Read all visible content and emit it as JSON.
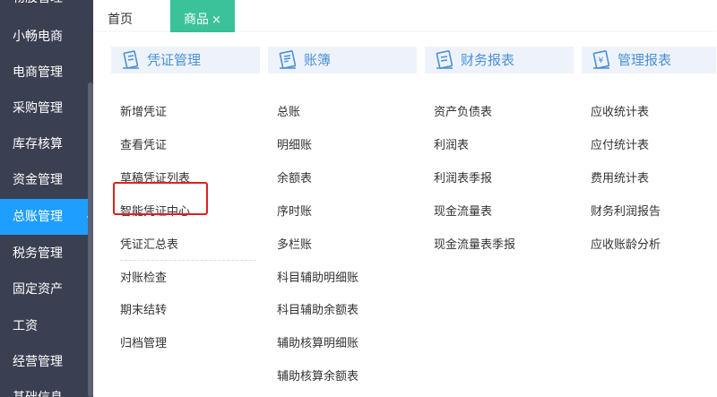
{
  "sidebar": {
    "items": [
      {
        "label": "物股管理",
        "active": false
      },
      {
        "label": "小畅电商",
        "active": false
      },
      {
        "label": "电商管理",
        "active": false
      },
      {
        "label": "采购管理",
        "active": false
      },
      {
        "label": "库存核算",
        "active": false
      },
      {
        "label": "资金管理",
        "active": false
      },
      {
        "label": "总账管理",
        "active": true
      },
      {
        "label": "税务管理",
        "active": false
      },
      {
        "label": "固定资产",
        "active": false
      },
      {
        "label": "工资",
        "active": false
      },
      {
        "label": "经营管理",
        "active": false
      },
      {
        "label": "基础信息",
        "active": false
      }
    ]
  },
  "tabs": {
    "home": "首页",
    "goods": "商品",
    "close": "×"
  },
  "columns": [
    {
      "title": "凭证管理",
      "icon": "voucher-icon",
      "items": [
        "新增凭证",
        "查看凭证",
        "草稿凭证列表",
        "智能凭证中心",
        "凭证汇总表",
        "对账检查",
        "期末结转",
        "归档管理"
      ]
    },
    {
      "title": "账簿",
      "icon": "ledger-icon",
      "items": [
        "总账",
        "明细账",
        "余额表",
        "序时账",
        "多栏账",
        "科目辅助明细账",
        "科目辅助余额表",
        "辅助核算明细账",
        "辅助核算余额表"
      ]
    },
    {
      "title": "财务报表",
      "icon": "report-icon",
      "items": [
        "资产负债表",
        "利润表",
        "利润表季报",
        "现金流量表",
        "现金流量表季报"
      ]
    },
    {
      "title": "管理报表",
      "icon": "management-report-icon",
      "items": [
        "应收统计表",
        "应付统计表",
        "费用统计表",
        "财务利润报告",
        "应收账龄分析"
      ]
    }
  ],
  "colors": {
    "sidebar_bg": "#3a3f51",
    "sidebar_active": "#1e9fff",
    "tab_active": "#3cc29a",
    "header_text": "#4a90d9",
    "highlight": "#e02020"
  }
}
